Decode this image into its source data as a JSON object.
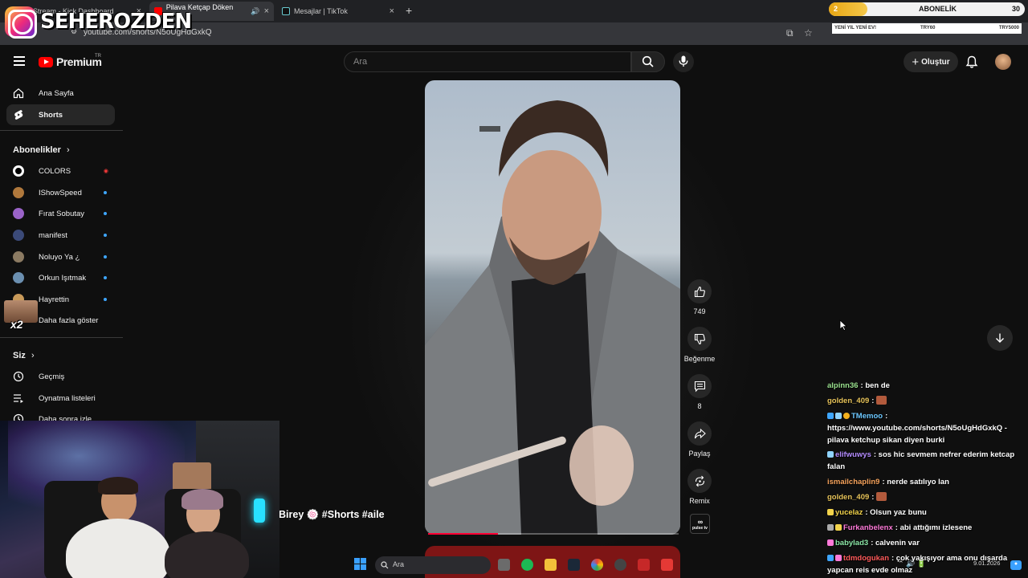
{
  "browser": {
    "tabs": [
      {
        "title": "Stream - Kick Dashboard",
        "active": false
      },
      {
        "title": "Pilava Ketçap Döken Bir",
        "active": true
      },
      {
        "title": "Mesajlar | TikTok",
        "active": false
      }
    ],
    "url": "youtube.com/shorts/N5oUgHdGxkQ"
  },
  "overlay": {
    "channel_name": "SEHEROZDEN",
    "sub_count": "2",
    "sub_title": "ABONELİK",
    "sub_goal": "30",
    "sub_bottom_left": "YENİ YIL YENİ EV!",
    "sub_bottom_mid": "TRY60",
    "sub_bottom_right": "TRY5000",
    "emote_label": "x2"
  },
  "header": {
    "logo": "Premium",
    "region": "TR",
    "search_placeholder": "Ara",
    "create_label": "Oluştur"
  },
  "sidebar": {
    "items": [
      {
        "label": "Ana Sayfa"
      },
      {
        "label": "Shorts"
      }
    ],
    "subscriptions_title": "Abonelikler",
    "subscriptions": [
      {
        "label": "COLORS",
        "live": true
      },
      {
        "label": "IShowSpeed"
      },
      {
        "label": "Fırat Sobutay"
      },
      {
        "label": "manifest"
      },
      {
        "label": "Noluyo Ya ¿"
      },
      {
        "label": "Orkun Işıtmak"
      },
      {
        "label": "Hayrettin"
      }
    ],
    "show_more": "Daha fazla göster",
    "you_title": "Siz",
    "you_items": [
      {
        "label": "Geçmiş"
      },
      {
        "label": "Oynatma listeleri"
      },
      {
        "label": "Daha sonra izle"
      }
    ]
  },
  "short": {
    "title": "Birey 🍥 #Shorts #aile",
    "progress": 0.28,
    "like_count": "749",
    "dislike_label": "Beğenme",
    "comment_count": "8",
    "share_label": "Paylaş",
    "remix_label": "Remix",
    "channel_badge": "pulse tv"
  },
  "chat": [
    {
      "user": "alpinn36",
      "color": "#9be28f",
      "text": ": ben de"
    },
    {
      "user": "golden_409",
      "color": "#e7c35a",
      "text": ":",
      "emote": true
    },
    {
      "user": "TMemoo",
      "color": "#6cc7ff",
      "text": ": https://www.youtube.com/shorts/N5oUgHdGxkQ - pilava ketchup sikan diyen burki"
    },
    {
      "user": "elifwuwys",
      "color": "#b48cff",
      "text": ": sos hic sevmem nefrer ederim ketcap falan"
    },
    {
      "user": "ismailchaplin9",
      "color": "#f6a35c",
      "text": ": nerde satılıyo lan"
    },
    {
      "user": "golden_409",
      "color": "#e7c35a",
      "text": ":",
      "emote": true
    },
    {
      "user": "yucelaz",
      "color": "#f2d34b",
      "text": ": Olsun yaz bunu"
    },
    {
      "user": "Furkanbelenx",
      "color": "#ff7ad9",
      "text": ": abi attığımı izlesene"
    },
    {
      "user": "babylad3",
      "color": "#8be6a6",
      "text": ": calvenin var"
    },
    {
      "user": "tdmdogukan",
      "color": "#ff5a5a",
      "text": ": çok yakışıyor ama onu dışarda yapcan reis evde olmaz"
    }
  ],
  "taskbar": {
    "search_placeholder": "Ara",
    "date": "9.01.2026"
  },
  "colors": {
    "accent_red": "#ff0000",
    "progress": "#ff0033",
    "link_blue": "#3ea6ff"
  }
}
